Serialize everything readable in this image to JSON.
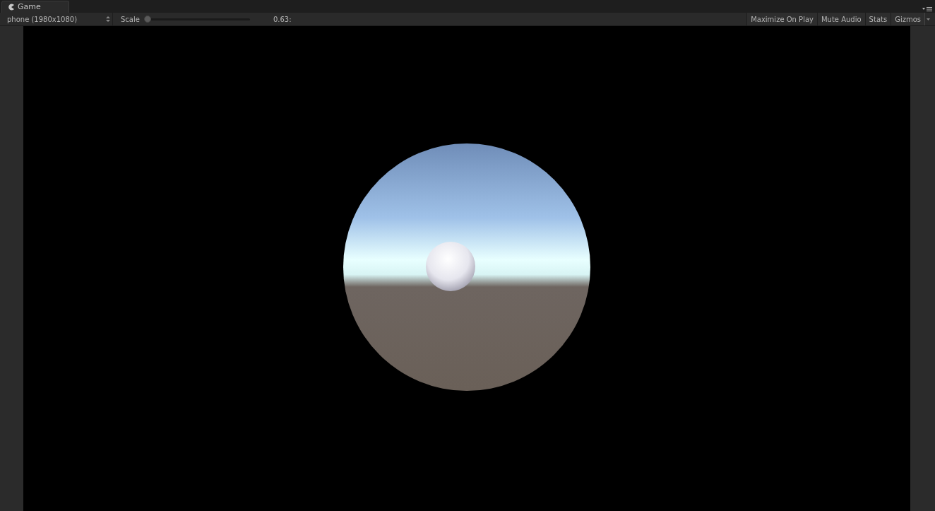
{
  "tab": {
    "label": "Game",
    "selected": true
  },
  "toolbar": {
    "resolution": "phone (1980x1080)",
    "scale_label": "Scale",
    "scale": {
      "level": 0
    },
    "scale_value": "0.63:",
    "toggles": [
      {
        "label": "Maximize On Play",
        "on": false
      },
      {
        "label": "Mute Audio",
        "on": false
      },
      {
        "label": "Stats",
        "on": false
      },
      {
        "label": "Gizmos",
        "on": false
      }
    ]
  }
}
